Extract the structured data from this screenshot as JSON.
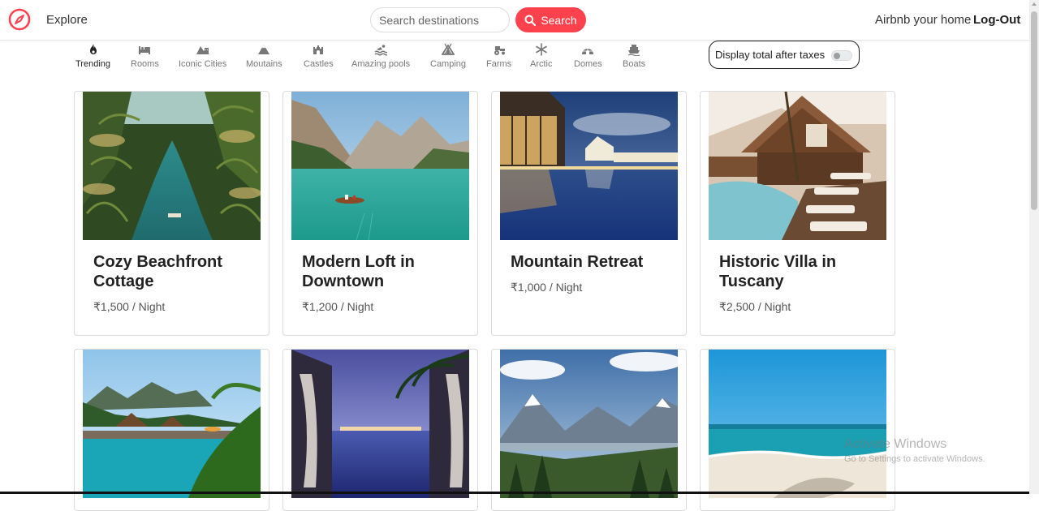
{
  "nav": {
    "brand_icon": "compass-icon",
    "explore_label": "Explore",
    "search_placeholder": "Search destinations",
    "search_button_label": "Search",
    "host_label": "Airbnb your home",
    "logout_label": "Log-Out",
    "accent_color": "#fe424d"
  },
  "filters": [
    {
      "label": "Trending",
      "icon": "fire-icon",
      "active": true
    },
    {
      "label": "Rooms",
      "icon": "bed-icon",
      "active": false
    },
    {
      "label": "Iconic Cities",
      "icon": "mountain-city-icon",
      "active": false
    },
    {
      "label": "Moutains",
      "icon": "mountain-icon",
      "active": false
    },
    {
      "label": "Castles",
      "icon": "castle-icon",
      "active": false
    },
    {
      "label": "Amazing pools",
      "icon": "person-swimming-icon",
      "active": false
    },
    {
      "label": "Camping",
      "icon": "campground-icon",
      "active": false
    },
    {
      "label": "Farms",
      "icon": "tractor-icon",
      "active": false
    },
    {
      "label": "Arctic",
      "icon": "snowflake-icon",
      "active": false
    },
    {
      "label": "Domes",
      "icon": "igloo-icon",
      "active": false
    },
    {
      "label": "Boats",
      "icon": "ship-icon",
      "active": false
    }
  ],
  "tax_toggle": {
    "label": "Display total after taxes",
    "checked": false
  },
  "listings": [
    {
      "title": "Cozy Beachfront Cottage",
      "price": "₹1,500",
      "per": " / Night",
      "image": "tropical-lagoon-photo"
    },
    {
      "title": "Modern Loft in Downtown",
      "price": "₹1,200",
      "per": " / Night",
      "image": "mountain-lake-boat-photo"
    },
    {
      "title": "Mountain Retreat",
      "price": "₹1,000",
      "per": " / Night",
      "image": "resort-pool-night-photo"
    },
    {
      "title": "Historic Villa in Tuscany",
      "price": "₹2,500",
      "per": " / Night",
      "image": "villa-pool-deck-photo"
    },
    {
      "title": "",
      "price": "",
      "per": "",
      "image": "tropical-resort-pool-photo"
    },
    {
      "title": "",
      "price": "",
      "per": "",
      "image": "infinity-pool-sunset-photo"
    },
    {
      "title": "",
      "price": "",
      "per": "",
      "image": "alpine-valley-photo"
    },
    {
      "title": "",
      "price": "",
      "per": "",
      "image": "sandy-beach-photo"
    }
  ],
  "os_watermark": {
    "line1": "Activate Windows",
    "line2": "Go to Settings to activate Windows."
  }
}
